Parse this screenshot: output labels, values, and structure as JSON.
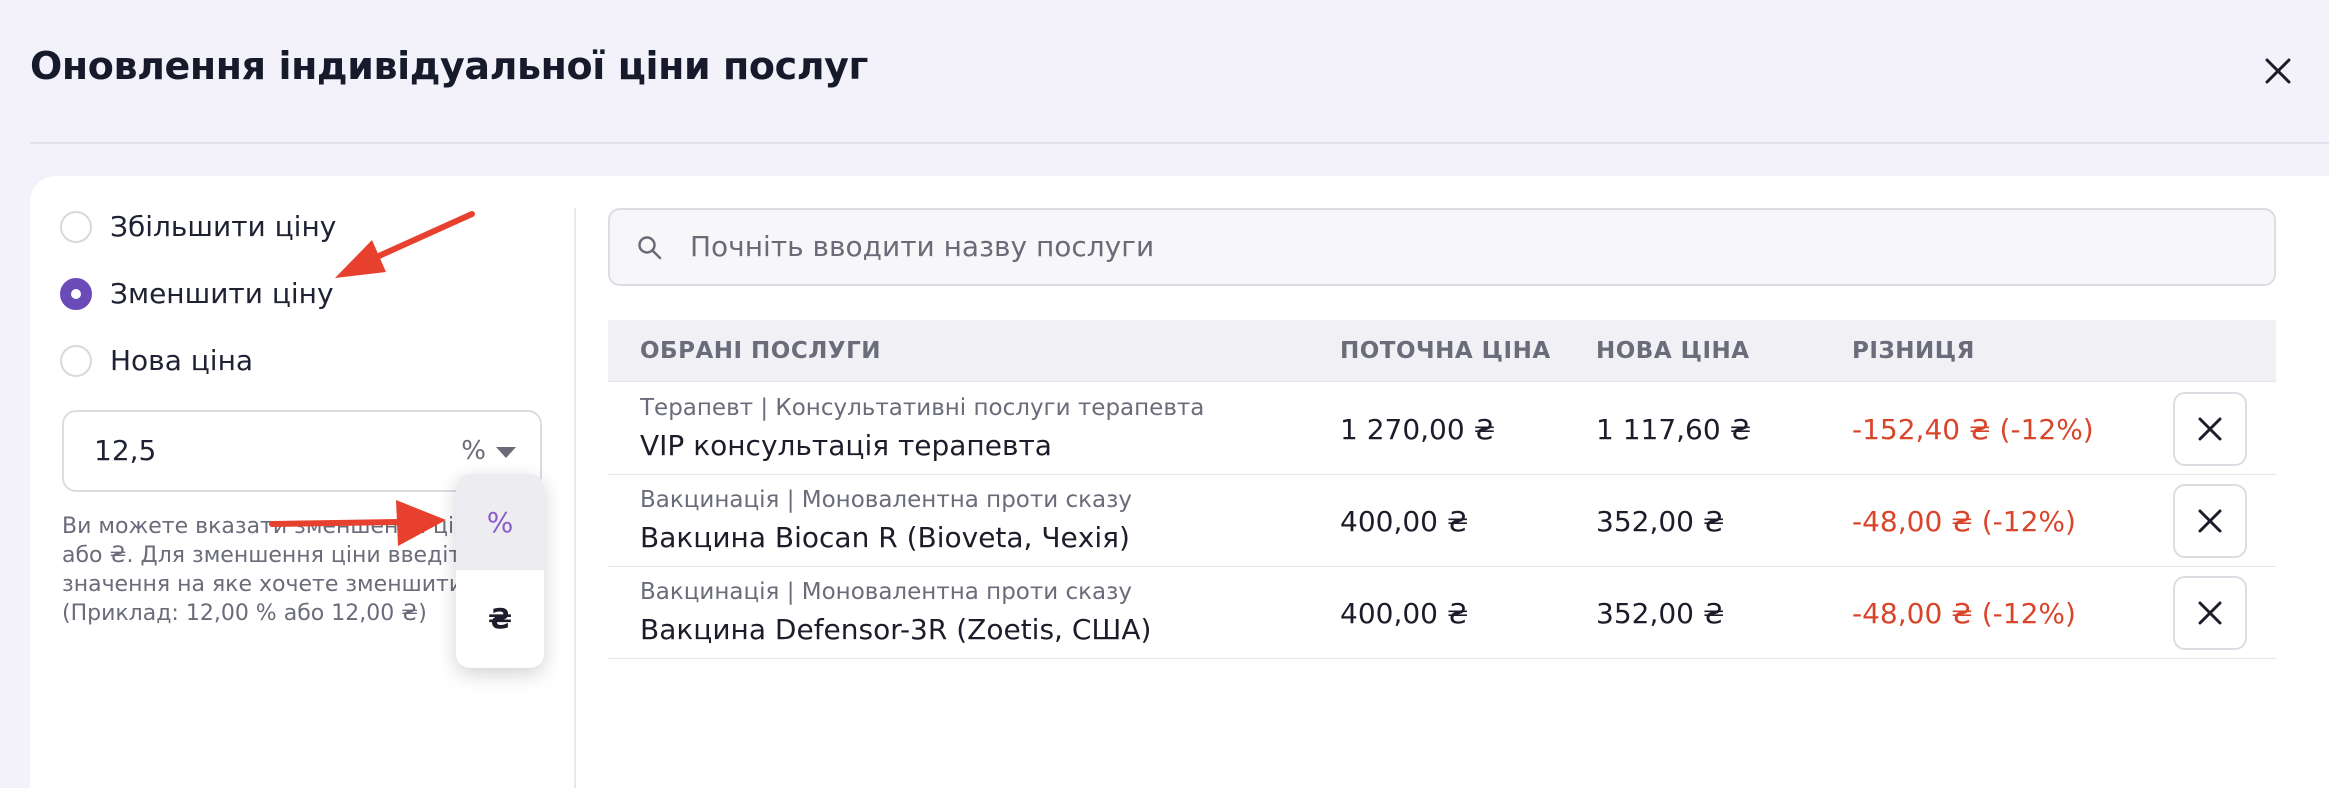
{
  "dialog": {
    "title": "Оновлення індивідуальної ціни послуг",
    "close_icon": "close-icon"
  },
  "adjustment": {
    "options": [
      {
        "label": "Збільшити ціну",
        "checked": false
      },
      {
        "label": "Зменшити ціну",
        "checked": true
      },
      {
        "label": "Нова ціна",
        "checked": false
      }
    ],
    "amount_value": "12,5",
    "unit_selected": "%",
    "unit_options": [
      "%",
      "₴"
    ],
    "help_lines": [
      "Ви можете вказати зменшення ціни у %",
      "або ₴. Для зменшення ціни введіть",
      "значення на яке хочете зменшити",
      "(Приклад: 12,00 % або 12,00 ₴)"
    ]
  },
  "search": {
    "placeholder": "Почніть вводити назву послуги",
    "icon": "search-icon"
  },
  "table": {
    "headers": [
      "ОБРАНІ ПОСЛУГИ",
      "ПОТОЧНА ЦІНА",
      "НОВА ЦІНА",
      "РІЗНИЦЯ"
    ],
    "rows": [
      {
        "category": "Терапевт | Консультативні послуги терапевта",
        "service": "VIP консультація терапевта",
        "current": "1 270,00 ₴",
        "new": "1 117,60 ₴",
        "difference": "-152,40 ₴ (-12%)"
      },
      {
        "category": "Вакцинація | Моновалентна проти сказу",
        "service": "Вакцина Biocan R (Bioveta, Чехія)",
        "current": "400,00 ₴",
        "new": "352,00 ₴",
        "difference": "-48,00 ₴ (-12%)"
      },
      {
        "category": "Вакцинація | Моновалентна проти сказу",
        "service": "Вакцина Defensor-3R (Zoetis, США)",
        "current": "400,00 ₴",
        "new": "352,00 ₴",
        "difference": "-48,00 ₴ (-12%)"
      }
    ]
  },
  "colors": {
    "accent": "#6a4bb8",
    "negative": "#d9452b",
    "annotation_arrow": "#e8402e"
  }
}
